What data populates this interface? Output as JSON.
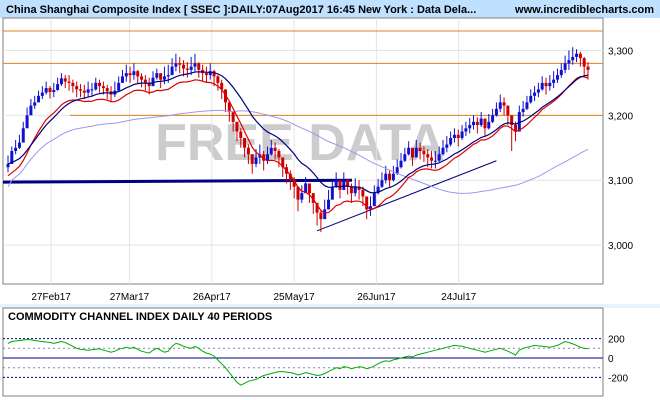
{
  "header": {
    "title": "China Shanghai Composite Index [ SSEC ]:DAILY:07Aug2017 16:45 New York : Data Dela...",
    "site": "www.incrediblecharts.com"
  },
  "watermark": "FREE DATA",
  "indicator": {
    "title": "COMMODITY CHANNEL INDEX DAILY 40 PERIODS"
  },
  "colors": {
    "background": "#ffffff",
    "header_band": "#bfe0ff",
    "panel_bg": "#ffffff",
    "up": "#1010d0",
    "down": "#cc0000",
    "ema_short": "#dd0000",
    "ema_long": "#000080",
    "ma_long": "#9999ee",
    "support": "#000080",
    "resistance": "#e08020",
    "cci": "#00aa00",
    "watermark": "#cccccc"
  },
  "chart_data": [
    {
      "type": "candlestick",
      "title": "China Shanghai Composite Index [ SSEC ]:DAILY:07Aug2017 16:45 New York : Data Dela...",
      "x_tick_labels": [
        "27Feb17",
        "27Mar17",
        "26Apr17",
        "25May17",
        "26Jun17",
        "24Jul17"
      ],
      "y_tick_labels": [
        "3,000",
        "3,100",
        "3,200",
        "3,300"
      ],
      "ylim": [
        2940,
        3350
      ],
      "grid": true,
      "close": [
        3125,
        3145,
        3150,
        3158,
        3180,
        3200,
        3215,
        3220,
        3230,
        3235,
        3242,
        3236,
        3239,
        3248,
        3257,
        3252,
        3250,
        3245,
        3240,
        3238,
        3235,
        3240,
        3240,
        3250,
        3245,
        3242,
        3237,
        3232,
        3238,
        3250,
        3260,
        3265,
        3262,
        3268,
        3260,
        3255,
        3250,
        3245,
        3258,
        3265,
        3255,
        3260,
        3262,
        3275,
        3280,
        3278,
        3272,
        3270,
        3275,
        3280,
        3270,
        3265,
        3262,
        3268,
        3260,
        3250,
        3240,
        3220,
        3205,
        3190,
        3175,
        3165,
        3150,
        3140,
        3125,
        3135,
        3140,
        3130,
        3140,
        3150,
        3145,
        3135,
        3120,
        3110,
        3100,
        3090,
        3070,
        3080,
        3095,
        3080,
        3065,
        3050,
        3040,
        3055,
        3070,
        3090,
        3100,
        3085,
        3100,
        3090,
        3080,
        3090,
        3085,
        3075,
        3055,
        3060,
        3080,
        3090,
        3100,
        3110,
        3100,
        3110,
        3120,
        3130,
        3140,
        3150,
        3135,
        3150,
        3145,
        3140,
        3135,
        3130,
        3130,
        3140,
        3150,
        3155,
        3165,
        3170,
        3165,
        3175,
        3180,
        3185,
        3190,
        3185,
        3195,
        3180,
        3190,
        3200,
        3210,
        3220,
        3215,
        3200,
        3185,
        3175,
        3205,
        3210,
        3220,
        3230,
        3235,
        3240,
        3250,
        3245,
        3250,
        3255,
        3262,
        3270,
        3280,
        3285,
        3290,
        3295,
        3288,
        3275,
        3270
      ],
      "high": [
        3138,
        3152,
        3162,
        3170,
        3190,
        3212,
        3225,
        3230,
        3238,
        3245,
        3252,
        3245,
        3250,
        3258,
        3265,
        3262,
        3262,
        3255,
        3252,
        3248,
        3247,
        3252,
        3250,
        3258,
        3255,
        3252,
        3247,
        3245,
        3252,
        3260,
        3270,
        3278,
        3275,
        3280,
        3270,
        3265,
        3262,
        3258,
        3268,
        3272,
        3265,
        3275,
        3278,
        3288,
        3295,
        3290,
        3285,
        3282,
        3290,
        3295,
        3282,
        3278,
        3275,
        3280,
        3270,
        3262,
        3255,
        3235,
        3218,
        3205,
        3190,
        3180,
        3165,
        3155,
        3140,
        3148,
        3155,
        3145,
        3152,
        3162,
        3158,
        3148,
        3135,
        3125,
        3115,
        3105,
        3090,
        3092,
        3105,
        3095,
        3080,
        3065,
        3055,
        3070,
        3085,
        3100,
        3112,
        3100,
        3112,
        3102,
        3095,
        3103,
        3100,
        3090,
        3072,
        3075,
        3092,
        3102,
        3112,
        3122,
        3115,
        3122,
        3132,
        3142,
        3150,
        3160,
        3150,
        3162,
        3158,
        3152,
        3148,
        3145,
        3145,
        3152,
        3162,
        3168,
        3175,
        3180,
        3178,
        3185,
        3190,
        3196,
        3200,
        3197,
        3205,
        3195,
        3202,
        3210,
        3220,
        3232,
        3228,
        3215,
        3200,
        3190,
        3215,
        3222,
        3230,
        3240,
        3245,
        3250,
        3260,
        3258,
        3262,
        3268,
        3272,
        3280,
        3292,
        3300,
        3305,
        3302,
        3298,
        3290,
        3282
      ],
      "low": [
        3112,
        3130,
        3140,
        3148,
        3165,
        3188,
        3203,
        3210,
        3220,
        3225,
        3232,
        3226,
        3228,
        3238,
        3245,
        3242,
        3238,
        3235,
        3228,
        3228,
        3225,
        3228,
        3230,
        3238,
        3235,
        3232,
        3225,
        3220,
        3228,
        3240,
        3250,
        3252,
        3250,
        3255,
        3248,
        3243,
        3238,
        3232,
        3245,
        3255,
        3242,
        3248,
        3250,
        3262,
        3268,
        3265,
        3260,
        3258,
        3262,
        3268,
        3258,
        3252,
        3250,
        3255,
        3245,
        3238,
        3225,
        3205,
        3190,
        3175,
        3160,
        3150,
        3135,
        3125,
        3110,
        3120,
        3125,
        3115,
        3125,
        3138,
        3132,
        3120,
        3105,
        3095,
        3085,
        3072,
        3052,
        3065,
        3080,
        3065,
        3048,
        3030,
        3020,
        3040,
        3055,
        3075,
        3088,
        3072,
        3085,
        3078,
        3065,
        3075,
        3070,
        3060,
        3040,
        3045,
        3065,
        3078,
        3088,
        3095,
        3088,
        3098,
        3108,
        3118,
        3128,
        3138,
        3122,
        3138,
        3132,
        3128,
        3120,
        3118,
        3118,
        3128,
        3138,
        3143,
        3152,
        3158,
        3152,
        3162,
        3168,
        3172,
        3178,
        3172,
        3182,
        3168,
        3178,
        3188,
        3198,
        3205,
        3200,
        3185,
        3145,
        3160,
        3192,
        3198,
        3208,
        3218,
        3222,
        3228,
        3238,
        3232,
        3238,
        3242,
        3250,
        3258,
        3265,
        3270,
        3278,
        3282,
        3275,
        3260,
        3255
      ]
    },
    {
      "type": "line",
      "title": "COMMODITY CHANNEL INDEX DAILY 40 PERIODS",
      "y_tick_labels": [
        "200",
        "0",
        "-200"
      ],
      "ylim": [
        -350,
        350
      ],
      "reference_lines": [
        200,
        100,
        0,
        -100,
        -200
      ],
      "series": [
        {
          "values": [
            150,
            170,
            175,
            180,
            185,
            190,
            188,
            180,
            175,
            170,
            165,
            160,
            150,
            160,
            170,
            160,
            140,
            120,
            100,
            90,
            85,
            80,
            85,
            90,
            95,
            80,
            70,
            60,
            70,
            90,
            100,
            110,
            100,
            110,
            90,
            70,
            60,
            50,
            80,
            100,
            80,
            60,
            70,
            120,
            150,
            140,
            120,
            110,
            100,
            120,
            100,
            70,
            50,
            40,
            20,
            -20,
            -60,
            -100,
            -150,
            -200,
            -250,
            -280,
            -260,
            -240,
            -230,
            -220,
            -200,
            -180,
            -170,
            -160,
            -150,
            -140,
            -140,
            -145,
            -150,
            -160,
            -175,
            -165,
            -150,
            -160,
            -170,
            -180,
            -175,
            -160,
            -140,
            -120,
            -100,
            -110,
            -90,
            -95,
            -110,
            -100,
            -90,
            -95,
            -110,
            -100,
            -80,
            -60,
            -40,
            -30,
            -35,
            -20,
            -10,
            0,
            10,
            20,
            10,
            30,
            40,
            50,
            60,
            70,
            80,
            90,
            100,
            110,
            120,
            130,
            125,
            120,
            110,
            100,
            90,
            80,
            70,
            60,
            70,
            80,
            90,
            100,
            85,
            70,
            50,
            30,
            80,
            100,
            110,
            120,
            130,
            125,
            120,
            115,
            110,
            120,
            130,
            150,
            170,
            160,
            145,
            130,
            110,
            100,
            95
          ]
        }
      ]
    }
  ]
}
